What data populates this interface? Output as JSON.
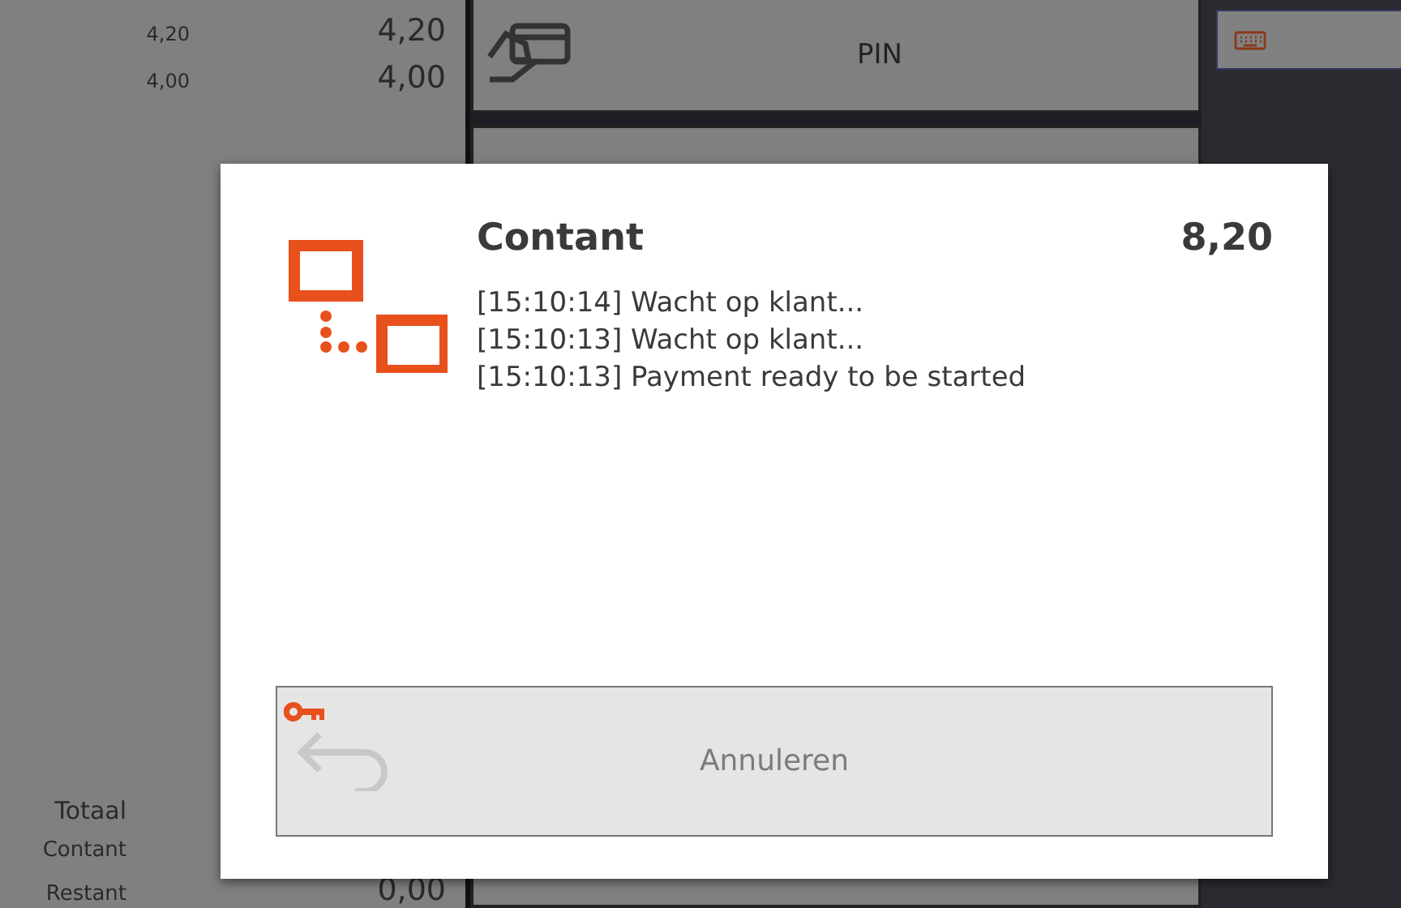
{
  "receipt": {
    "lines": [
      {
        "unit_price": "4,20",
        "amount": "4,20"
      },
      {
        "unit_price": "4,00",
        "amount": "4,00"
      }
    ],
    "totals": [
      {
        "label": "Totaal"
      },
      {
        "label": "Contant"
      },
      {
        "label": "Restant",
        "value": "0,00"
      }
    ]
  },
  "payment_buttons": [
    {
      "label": "PIN"
    }
  ],
  "dialog": {
    "title": "Contant",
    "amount": "8,20",
    "log": [
      "[15:10:14] Wacht op klant...",
      "[15:10:13] Wacht op klant...",
      "[15:10:13] Payment ready to be started"
    ],
    "cancel_button": {
      "label": "Annuleren"
    }
  }
}
